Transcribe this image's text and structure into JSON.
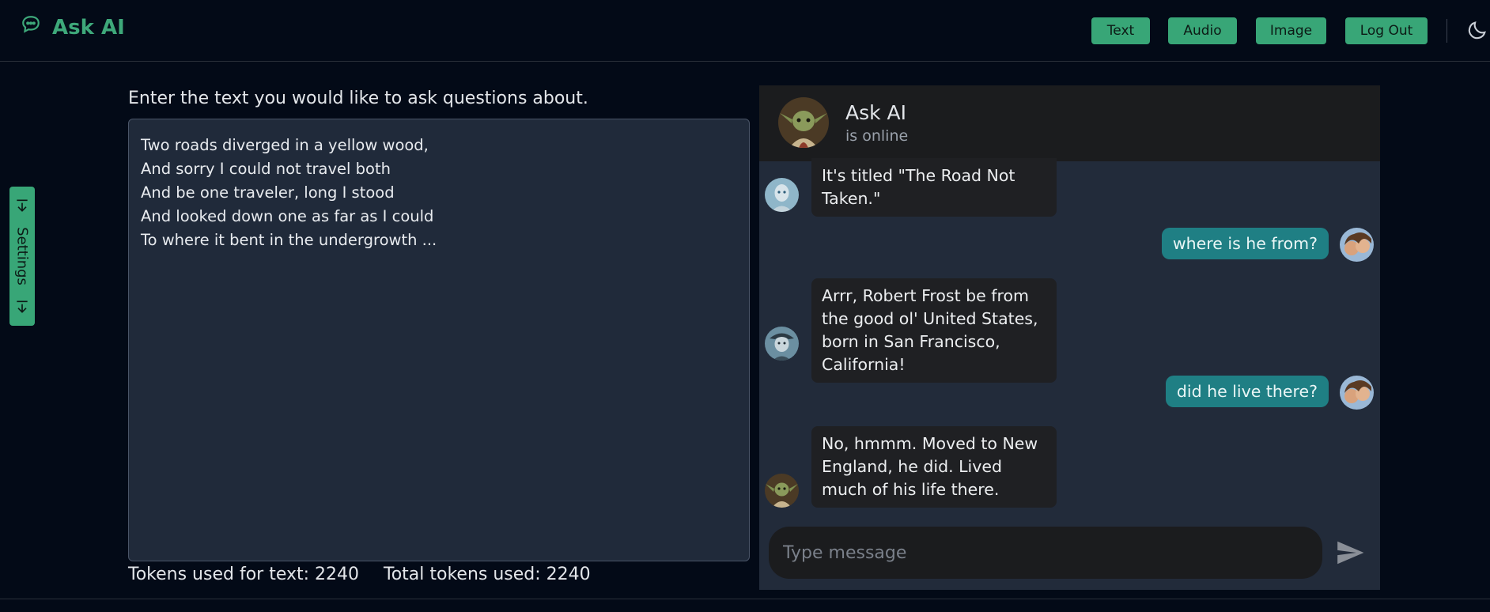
{
  "app": {
    "title": "Ask AI",
    "accent_color": "#38a677"
  },
  "nav": {
    "buttons": [
      {
        "label": "Text"
      },
      {
        "label": "Audio"
      },
      {
        "label": "Image"
      },
      {
        "label": "Log Out"
      }
    ],
    "theme_toggle_icon": "moon-icon"
  },
  "settings": {
    "label": "Settings"
  },
  "editor": {
    "prompt": "Enter the text you would like to ask questions about.",
    "lines": [
      "Two roads diverged in a yellow wood,",
      "And sorry I could not travel both",
      "And be one traveler, long I stood",
      "And looked down one as far as I could",
      "To where it bent in the undergrowth ..."
    ],
    "tokens_text": "Tokens used for text: 2240",
    "tokens_total": "Total tokens used: 2240"
  },
  "chat": {
    "title": "Ask AI",
    "status": "is online",
    "messages": [
      {
        "from": "ai",
        "text": "It's titled \"The Road Not Taken.\"",
        "avatar": "robot-avatar"
      },
      {
        "from": "user",
        "text": "where is he from?",
        "avatar": "user-avatar"
      },
      {
        "from": "ai",
        "text": "Arrr, Robert Frost be from the good ol' United States, born in San Francisco, California!",
        "avatar": "pirate-avatar"
      },
      {
        "from": "user",
        "text": "did he live there?",
        "avatar": "user-avatar"
      },
      {
        "from": "ai",
        "text": "No, hmmm. Moved to New England, he did. Lived much of his life there.",
        "avatar": "yoda-avatar"
      }
    ],
    "input_placeholder": "Type message",
    "send_icon": "send-icon",
    "user_bubble_color": "#1f7f84"
  }
}
